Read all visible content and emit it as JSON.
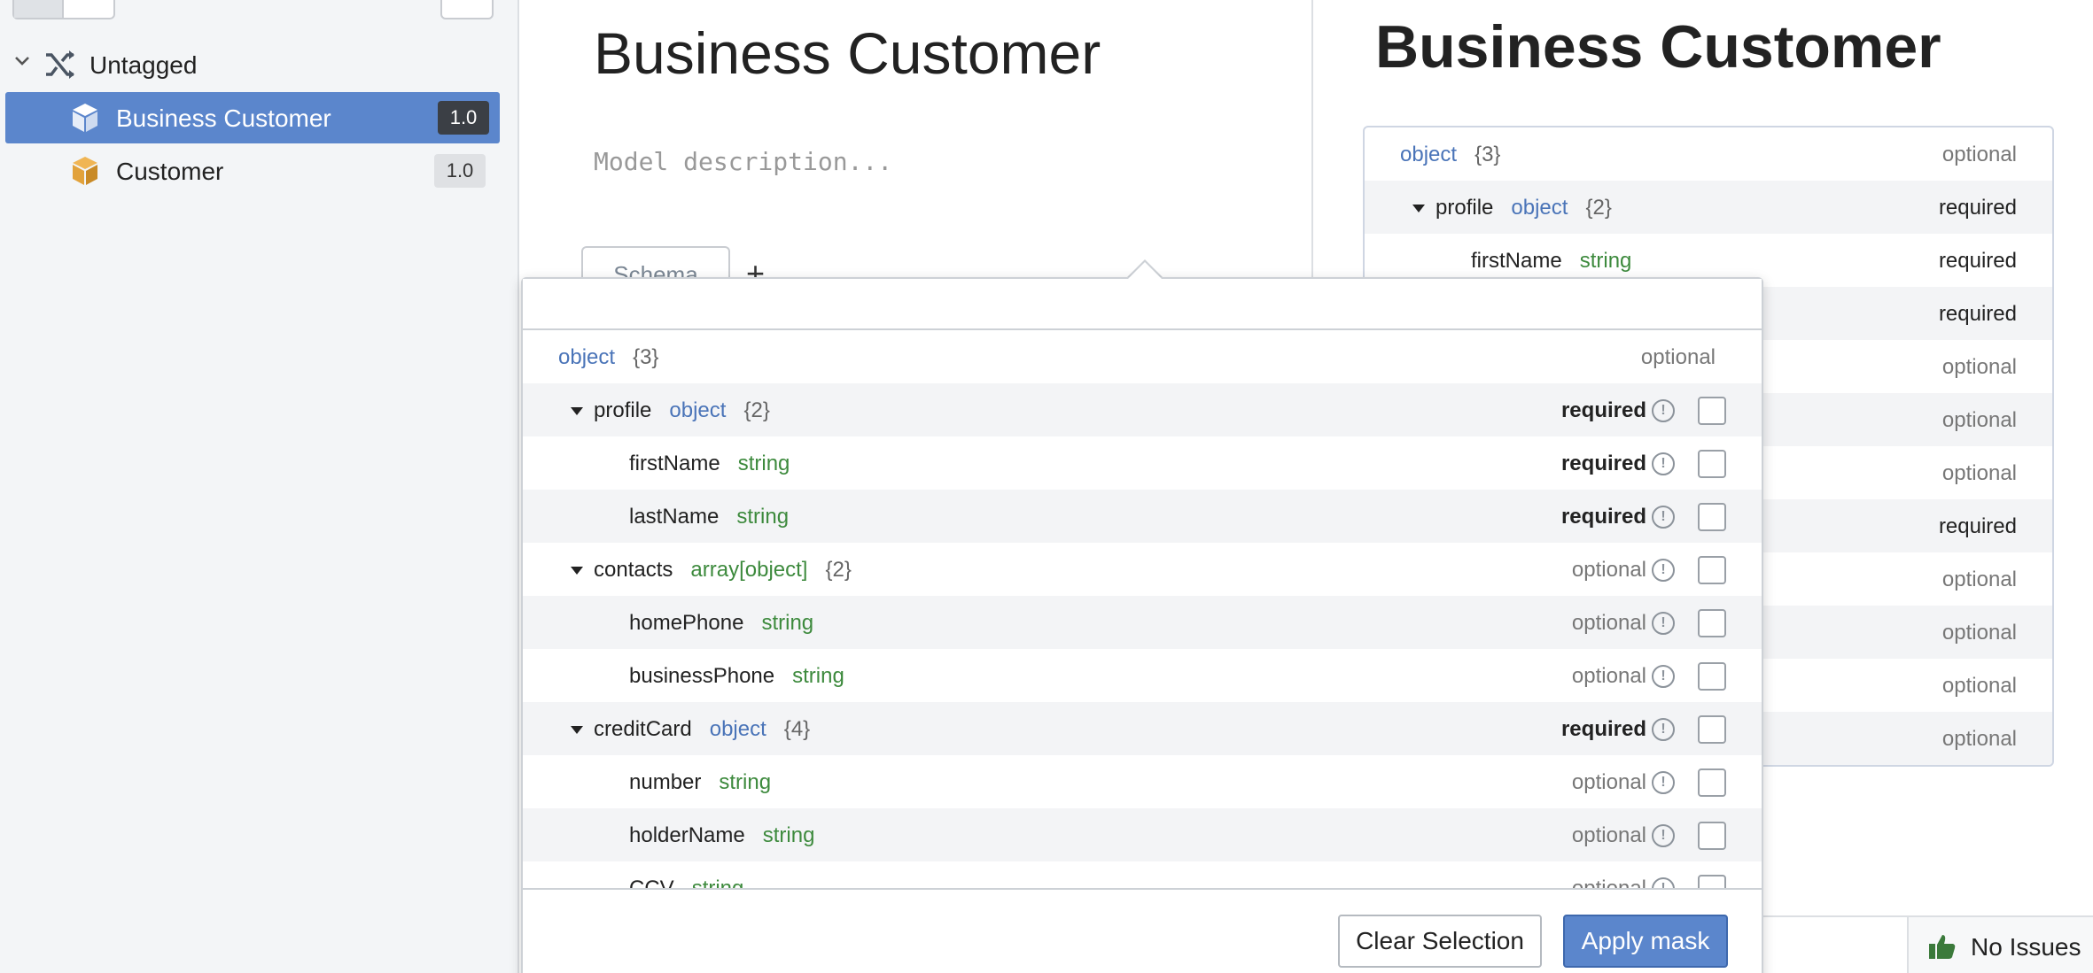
{
  "sidebar": {
    "group_label": "Untagged",
    "items": [
      {
        "label": "Business Customer",
        "version": "1.0",
        "selected": true
      },
      {
        "label": "Customer",
        "version": "1.0",
        "selected": false
      }
    ]
  },
  "editor": {
    "title": "Business Customer",
    "description_placeholder": "Model description...",
    "tab_label": "Schema",
    "add_tab": "+"
  },
  "preview": {
    "title": "Business Customer",
    "rows": [
      {
        "name": "",
        "type": "object",
        "count": "{3}",
        "status": "optional"
      },
      {
        "name": "profile",
        "type": "object",
        "count": "{2}",
        "status": "required"
      },
      {
        "name": "firstName",
        "type": "string",
        "count": "",
        "status": "required"
      },
      {
        "status": "required"
      },
      {
        "status": "optional"
      },
      {
        "status": "optional"
      },
      {
        "status": "optional"
      },
      {
        "status": "required"
      },
      {
        "status": "optional"
      },
      {
        "status": "optional"
      },
      {
        "status": "optional"
      },
      {
        "status": "optional"
      }
    ]
  },
  "mask_popover": {
    "search_placeholder": "",
    "root": {
      "type": "object",
      "count": "{3}",
      "status": "optional"
    },
    "rows": [
      {
        "name": "profile",
        "type": "object",
        "count": "{2}",
        "status": "required"
      },
      {
        "name": "firstName",
        "type": "string",
        "count": "",
        "status": "required"
      },
      {
        "name": "lastName",
        "type": "string",
        "count": "",
        "status": "required"
      },
      {
        "name": "contacts",
        "type": "array[object]",
        "count": "{2}",
        "status": "optional"
      },
      {
        "name": "homePhone",
        "type": "string",
        "count": "",
        "status": "optional"
      },
      {
        "name": "businessPhone",
        "type": "string",
        "count": "",
        "status": "optional"
      },
      {
        "name": "creditCard",
        "type": "object",
        "count": "{4}",
        "status": "required"
      },
      {
        "name": "number",
        "type": "string",
        "count": "",
        "status": "optional"
      },
      {
        "name": "holderName",
        "type": "string",
        "count": "",
        "status": "optional"
      },
      {
        "name": "CCV",
        "type": "string",
        "count": "",
        "status": "optional"
      }
    ],
    "clear_label": "Clear Selection",
    "apply_label": "Apply mask"
  },
  "statusbar": {
    "issues_label": "No Issues"
  },
  "colors": {
    "accent": "#5b86cc",
    "type_object": "#4a74b8",
    "type_string": "#3d8a3d",
    "cube_icon": "#e2a23b"
  },
  "icons": {
    "group": "shuffle-icon",
    "model": "cube-icon",
    "issues": "thumbs-up-icon"
  }
}
